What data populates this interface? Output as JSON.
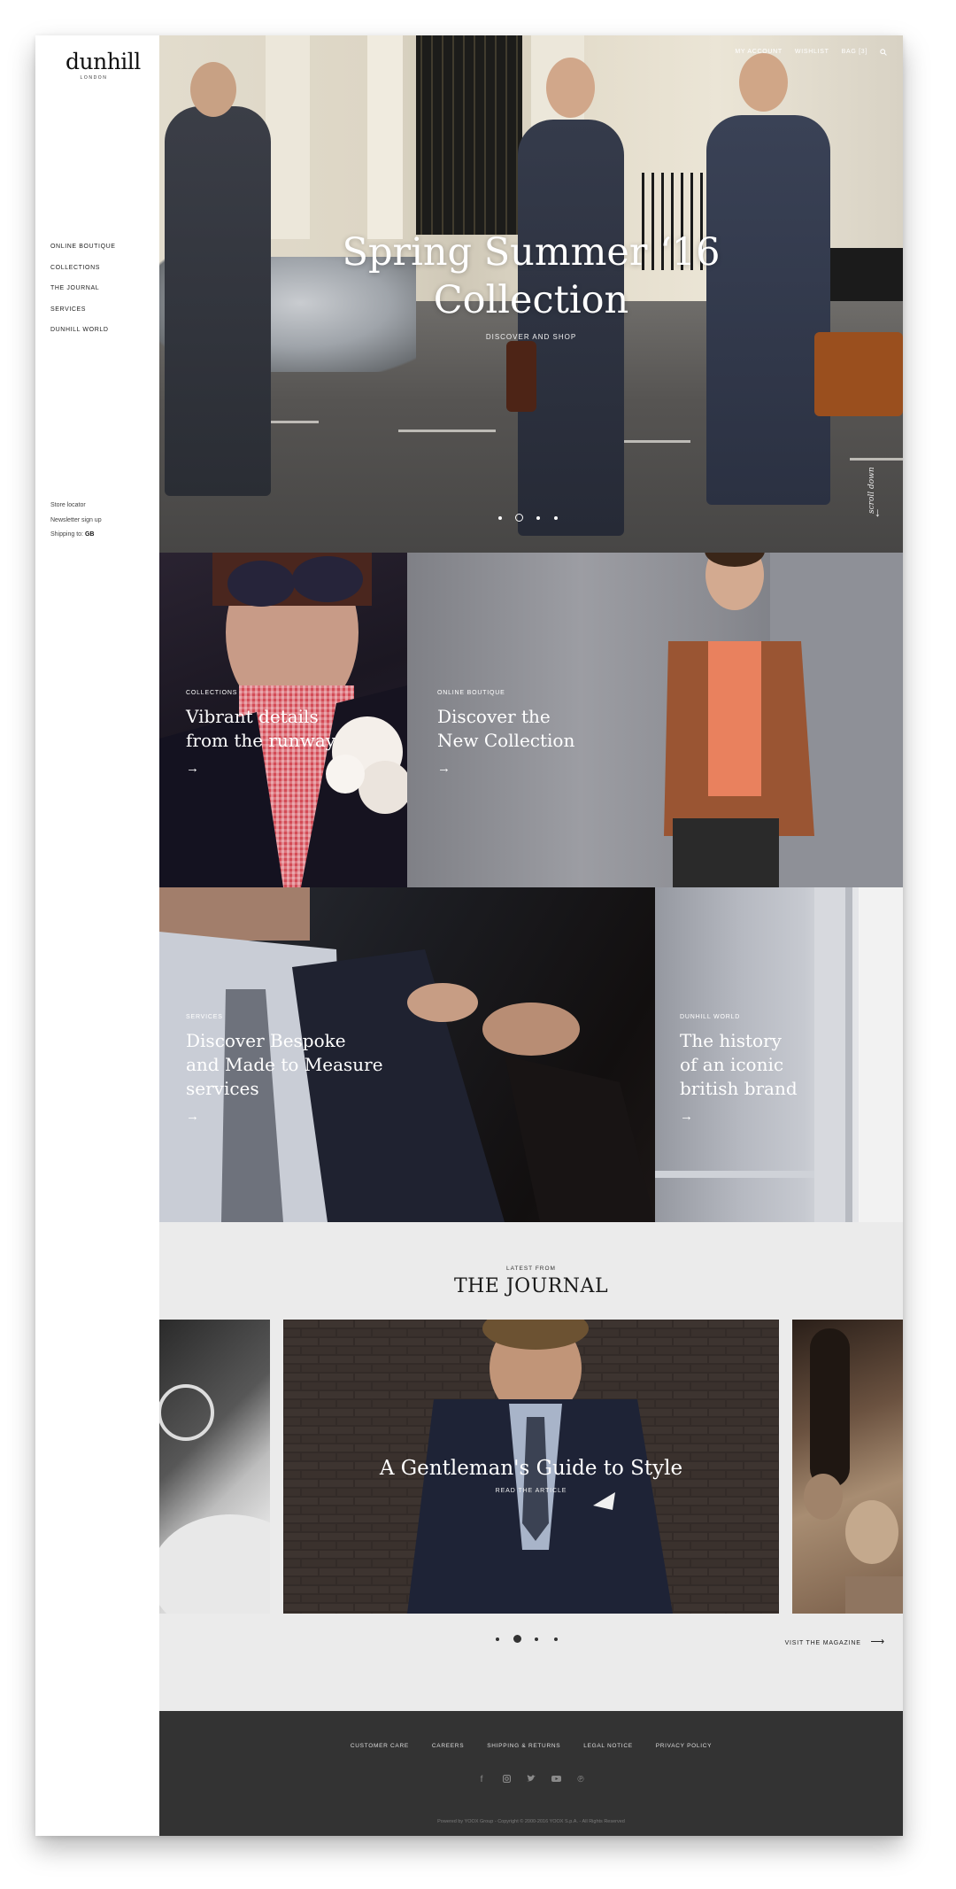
{
  "brand": {
    "logo_text": "dunhill",
    "logo_sub": "LONDON"
  },
  "sidebar": {
    "nav": [
      "ONLINE BOUTIQUE",
      "COLLECTIONS",
      "THE JOURNAL",
      "SERVICES",
      "DUNHILL WORLD"
    ],
    "utility": {
      "store_locator": "Store locator",
      "newsletter": "Newsletter sign up",
      "shipping_label": "Shipping to:",
      "shipping_value": "GB"
    }
  },
  "top_nav": {
    "account": "MY ACCOUNT",
    "wishlist": "WISHLIST",
    "bag": "BAG [3]",
    "search_icon": "search-icon"
  },
  "hero": {
    "title_line1": "Spring Summer ‘16",
    "title_line2": "Collection",
    "cta": "DISCOVER AND SHOP",
    "scroll": "scroll down",
    "slides": 4,
    "active_slide": 2
  },
  "tiles": [
    {
      "kicker": "COLLECTIONS",
      "line1": "Vibrant details",
      "line2": "from the runway",
      "arrow": "→"
    },
    {
      "kicker": "ONLINE BOUTIQUE",
      "line1": "Discover the",
      "line2": "New Collection",
      "arrow": "→"
    },
    {
      "kicker": "SERVICES",
      "line1": "Discover Bespoke",
      "line2": "and Made to Measure",
      "line3": "services",
      "arrow": "→"
    },
    {
      "kicker": "DUNHILL WORLD",
      "line1": "The history",
      "line2": "of an iconic",
      "line3": "british brand",
      "arrow": "→"
    }
  ],
  "journal": {
    "kicker": "LATEST FROM",
    "title": "THE JOURNAL",
    "slide_title": "A Gentleman's Guide to Style",
    "slide_cta": "READ THE ARTICLE",
    "visit": "VISIT THE MAGAZINE",
    "visit_arrow": "⟶",
    "slides": 4,
    "active_slide": 2
  },
  "footer": {
    "links": [
      "CUSTOMER CARE",
      "CAREERS",
      "SHIPPING & RETURNS",
      "LEGAL NOTICE",
      "PRIVACY POLICY"
    ],
    "social_icons": [
      "facebook-icon",
      "instagram-icon",
      "twitter-icon",
      "youtube-icon",
      "pinterest-icon"
    ],
    "copyright": "Powered by YOOX Group - Copyright © 2000-2016 YOOX S.p.A. - All Rights Reserved"
  },
  "colors": {
    "footer_bg": "#333333",
    "journal_bg": "#ebebeb",
    "text_dark": "#1a1a1a"
  }
}
